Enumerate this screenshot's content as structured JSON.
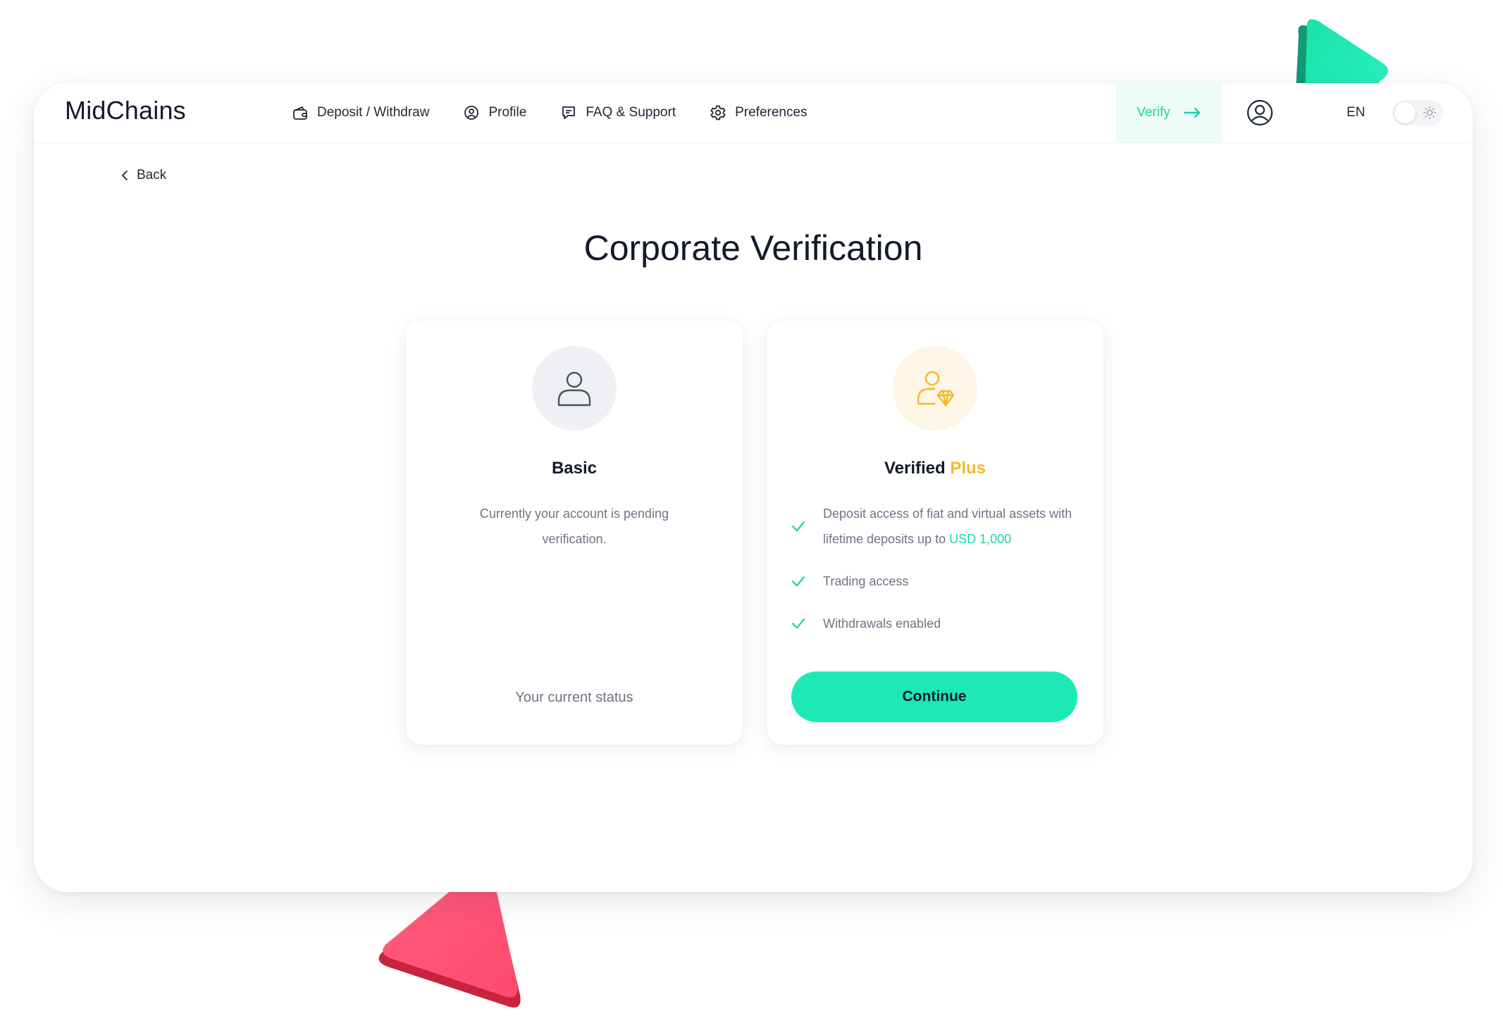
{
  "app": {
    "brand": "MidChains"
  },
  "nav": {
    "items": [
      {
        "label": "Deposit / Withdraw",
        "icon": "wallet-icon"
      },
      {
        "label": "Profile",
        "icon": "profile-icon"
      },
      {
        "label": "FAQ & Support",
        "icon": "chat-icon"
      },
      {
        "label": "Preferences",
        "icon": "gear-icon"
      }
    ],
    "verify_label": "Verify",
    "language": "EN"
  },
  "page": {
    "back_label": "Back",
    "title": "Corporate Verification"
  },
  "tiers": {
    "basic": {
      "name": "Basic",
      "description": "Currently your account is pending verification.",
      "status": "Your current status"
    },
    "plus": {
      "name": "Verified",
      "name_accent": "Plus",
      "features": [
        {
          "text": "Deposit access of fiat and virtual assets with lifetime deposits up to ",
          "highlight": "USD 1,000"
        },
        {
          "text": "Trading access",
          "highlight": ""
        },
        {
          "text": "Withdrawals enabled",
          "highlight": ""
        }
      ],
      "cta_label": "Continue"
    }
  },
  "colors": {
    "accent": "#1de9b6",
    "accent_text": "#1ad4a5",
    "gold": "#f5b72b",
    "pink_deco": "#ff4d6d"
  }
}
